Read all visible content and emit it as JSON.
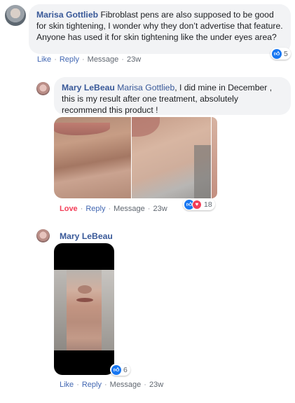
{
  "comments": [
    {
      "author": "Marisa Gottlieb",
      "text": "Fibroblast pens are also supposed to be good for skin tightening, I wonder why they don’t advertise that feature. Anyone has used it for skin tightening like the under eyes area?",
      "actions": {
        "like": "Like",
        "reply": "Reply",
        "message": "Message",
        "time": "23w"
      },
      "reactions": {
        "count": "5"
      }
    },
    {
      "author": "Mary LeBeau",
      "mention": "Marisa Gottlieb",
      "text": ", I did mine in December , this is my result after one treatment, absolutely recommend this product !",
      "actions": {
        "like": "Love",
        "reply": "Reply",
        "message": "Message",
        "time": "23w"
      },
      "reactions": {
        "count": "18"
      }
    },
    {
      "author": "Mary LeBeau",
      "actions": {
        "like": "Like",
        "reply": "Reply",
        "message": "Message",
        "time": "23w"
      },
      "reactions": {
        "count": "6"
      }
    }
  ],
  "separator": "·",
  "colors": {
    "link": "#385898",
    "love": "#f33e58",
    "like_react": "#1877f2",
    "bubble": "#f2f3f5"
  },
  "icons": {
    "like_reaction": "thumbs-up-icon",
    "love_reaction": "heart-icon"
  }
}
